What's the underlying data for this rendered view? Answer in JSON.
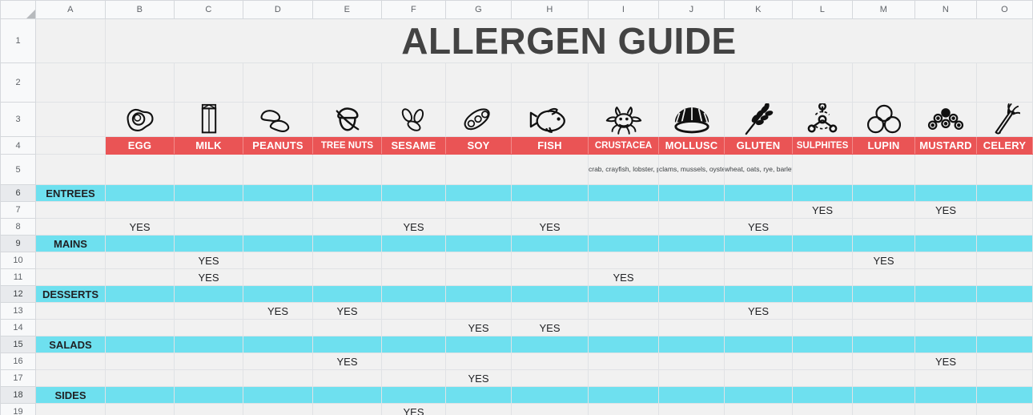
{
  "app": {
    "type": "spreadsheet"
  },
  "title": {
    "text": "ALLERGEN GUIDE"
  },
  "columns": [
    "A",
    "B",
    "C",
    "D",
    "E",
    "F",
    "G",
    "H",
    "I",
    "J",
    "K",
    "L",
    "M",
    "N",
    "O"
  ],
  "rows": [
    "1",
    "2",
    "3",
    "4",
    "5",
    "6",
    "7",
    "8",
    "9",
    "10",
    "11",
    "12",
    "13",
    "14",
    "15",
    "16",
    "17",
    "18",
    "19"
  ],
  "colors": {
    "allergen_band": "#ea5455",
    "category_band": "#6ee0ef",
    "cell_fill": "#f1f1f1",
    "title_text": "#434343",
    "header_fill": "#f8f9fa"
  },
  "allergens": [
    {
      "col": "B",
      "name": "EGG",
      "icon": "egg-icon",
      "desc": ""
    },
    {
      "col": "C",
      "name": "MILK",
      "icon": "milk-carton-icon",
      "desc": ""
    },
    {
      "col": "D",
      "name": "PEANUTS",
      "icon": "peanuts-icon",
      "desc": ""
    },
    {
      "col": "E",
      "name": "TREE NUTS",
      "icon": "acorn-icon",
      "desc": ""
    },
    {
      "col": "F",
      "name": "SESAME",
      "icon": "sesame-seeds-icon",
      "desc": ""
    },
    {
      "col": "G",
      "name": "SOY",
      "icon": "soy-pod-icon",
      "desc": ""
    },
    {
      "col": "H",
      "name": "FISH",
      "icon": "fish-icon",
      "desc": ""
    },
    {
      "col": "I",
      "name": "CRUSTACEA",
      "icon": "crab-icon",
      "desc": "crab, crayfish, lobster, prawns, shrimp"
    },
    {
      "col": "J",
      "name": "MOLLUSC",
      "icon": "shell-icon",
      "desc": "clams, mussels, oysters, scallops, octopus, snail, squid"
    },
    {
      "col": "K",
      "name": "GLUTEN",
      "icon": "wheat-icon",
      "desc": "wheat, oats, rye, barley"
    },
    {
      "col": "L",
      "name": "SULPHITES",
      "icon": "molecule-icon",
      "desc": ""
    },
    {
      "col": "M",
      "name": "LUPIN",
      "icon": "lupin-beans-icon",
      "desc": ""
    },
    {
      "col": "N",
      "name": "MUSTARD",
      "icon": "mustard-seeds-icon",
      "desc": ""
    },
    {
      "col": "O",
      "name": "CELERY",
      "icon": "celery-icon",
      "desc": ""
    }
  ],
  "categories": [
    {
      "row": 6,
      "label": "ENTREES"
    },
    {
      "row": 9,
      "label": "MAINS"
    },
    {
      "row": 12,
      "label": "DESSERTS"
    },
    {
      "row": 15,
      "label": "SALADS"
    },
    {
      "row": 18,
      "label": "SIDES"
    }
  ],
  "yes_label": "YES",
  "matrix": [
    {
      "row": 7,
      "cols": [
        "L",
        "N"
      ]
    },
    {
      "row": 8,
      "cols": [
        "B",
        "F",
        "H",
        "K"
      ]
    },
    {
      "row": 10,
      "cols": [
        "C",
        "M"
      ]
    },
    {
      "row": 11,
      "cols": [
        "C",
        "I"
      ]
    },
    {
      "row": 13,
      "cols": [
        "D",
        "E",
        "K"
      ]
    },
    {
      "row": 14,
      "cols": [
        "G",
        "H"
      ]
    },
    {
      "row": 16,
      "cols": [
        "E",
        "N"
      ]
    },
    {
      "row": 17,
      "cols": [
        "G"
      ]
    },
    {
      "row": 19,
      "cols": [
        "F"
      ]
    }
  ]
}
